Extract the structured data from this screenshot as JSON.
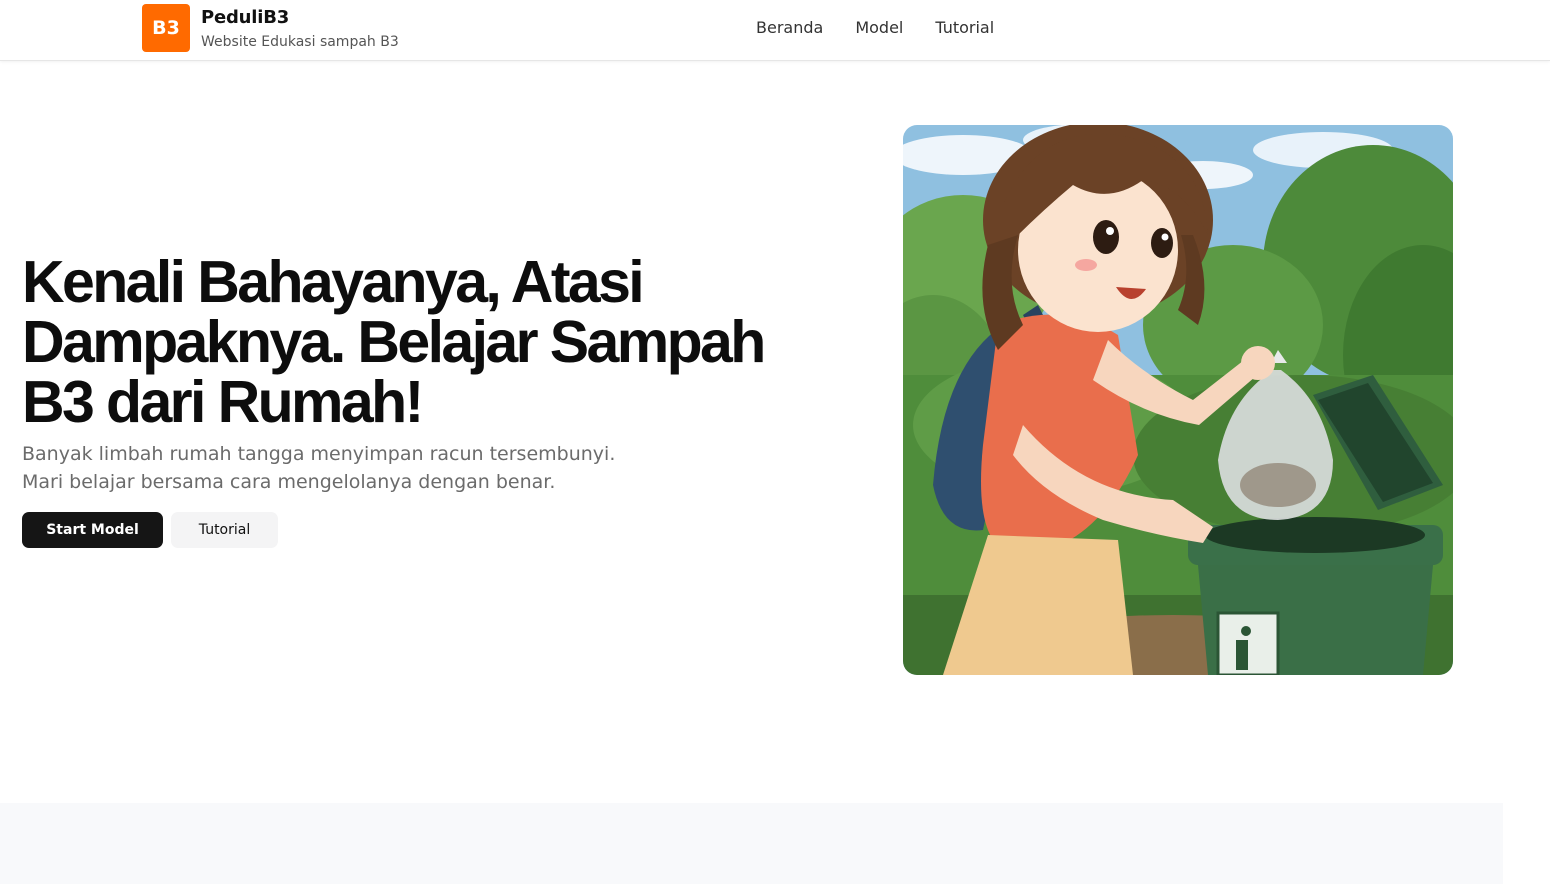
{
  "brand": {
    "logo_text": "B3",
    "name": "PeduliB3",
    "tagline": "Website Edukasi sampah B3",
    "accent_color": "#ff6a00"
  },
  "nav": {
    "items": [
      {
        "label": "Beranda"
      },
      {
        "label": "Model"
      },
      {
        "label": "Tutorial"
      }
    ]
  },
  "hero": {
    "title_lines": [
      "Kenali Bahayanya, Atasi",
      "Dampaknya. Belajar Sampah",
      "B3 dari Rumah!"
    ],
    "subtitle_lines": [
      "Banyak limbah rumah tangga menyimpan racun tersembunyi.",
      "Mari belajar bersama cara mengelolanya dengan benar."
    ],
    "primary_button": "Start Model",
    "secondary_button": "Tutorial",
    "illustration_icon": "girl-throwing-trash-illustration"
  }
}
